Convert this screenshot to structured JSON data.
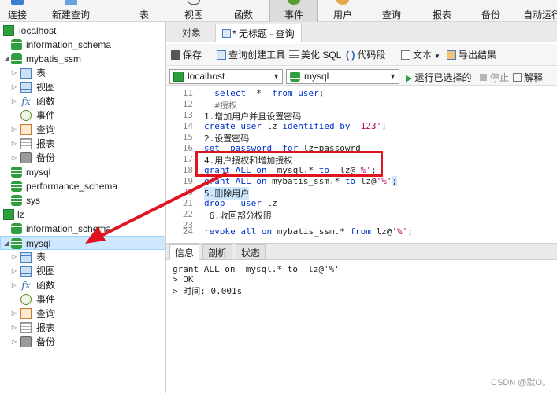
{
  "toolbar": {
    "buttons": [
      {
        "label": "连接",
        "icon": "connect-icon"
      },
      {
        "label": "新建查询",
        "icon": "new-query-icon"
      },
      {
        "label": "表",
        "icon": "table-icon"
      },
      {
        "label": "视图",
        "icon": "view-icon"
      },
      {
        "label": "函数",
        "icon": "function-icon"
      },
      {
        "label": "事件",
        "icon": "event-icon"
      },
      {
        "label": "用户",
        "icon": "user-icon"
      },
      {
        "label": "查询",
        "icon": "query-icon"
      },
      {
        "label": "报表",
        "icon": "report-icon"
      },
      {
        "label": "备份",
        "icon": "backup-icon"
      },
      {
        "label": "自动运行",
        "icon": "autorun-icon"
      }
    ]
  },
  "tree": {
    "localhost": "localhost",
    "dbs1": [
      "information_schema",
      "mybatis_ssm"
    ],
    "mybatis_children": [
      "表",
      "视图",
      "函数",
      "事件",
      "查询",
      "报表",
      "备份"
    ],
    "dbs1b": [
      "mysql",
      "performance_schema",
      "sys"
    ],
    "lz": "lz",
    "dbs2": [
      "information_schema",
      "mysql"
    ],
    "mysql_children": [
      "表",
      "视图",
      "函数",
      "事件",
      "查询",
      "报表",
      "备份"
    ]
  },
  "tabs": {
    "objects": "对象",
    "query": "* 无标题 - 查询"
  },
  "query_toolbar": {
    "save": "保存",
    "builder": "查询创建工具",
    "beautify": "美化 SQL",
    "snippet": "代码段",
    "text": "文本",
    "export": "导出结果"
  },
  "connection": {
    "conn_value": "localhost",
    "db_value": "mysql",
    "run_selected": "运行已选择的",
    "stop": "停止",
    "explain": "解释"
  },
  "editor": {
    "lines": [
      {
        "n": "11",
        "text": "  select  *  from user;"
      },
      {
        "n": "12",
        "text": "  #授权"
      },
      {
        "n": "13",
        "text": "1.增加用户并且设置密码"
      },
      {
        "n": "14",
        "text": "create user lz identified by '123';"
      },
      {
        "n": "15",
        "text": "2.设置密码"
      },
      {
        "n": "16",
        "text": "set  password  for lz=passowrd"
      },
      {
        "n": "17",
        "text": "4.用户授权和增加授权"
      },
      {
        "n": "18",
        "text": "grant ALL on  mysql.* to  lz@'%';"
      },
      {
        "n": "19",
        "text": "grant ALL on mybatis_ssm.* to lz@'%';"
      },
      {
        "n": "20",
        "text": "5.删除用户"
      },
      {
        "n": "21",
        "text": "drop   user lz"
      },
      {
        "n": "22",
        "text": " 6.收回部分权限"
      },
      {
        "n": "23",
        "text": ""
      },
      {
        "n": "24",
        "text": "revoke all on mybatis_ssm.* from lz@'%';"
      }
    ]
  },
  "result_tabs": [
    "信息",
    "剖析",
    "状态"
  ],
  "result": {
    "lines": [
      "grant ALL on  mysql.* to  lz@'%'",
      "> OK",
      "> 时间: 0.001s"
    ]
  },
  "watermark": "CSDN @默O。",
  "colors": {
    "annotation": "#e0141e",
    "selection": "#cde8ff"
  }
}
